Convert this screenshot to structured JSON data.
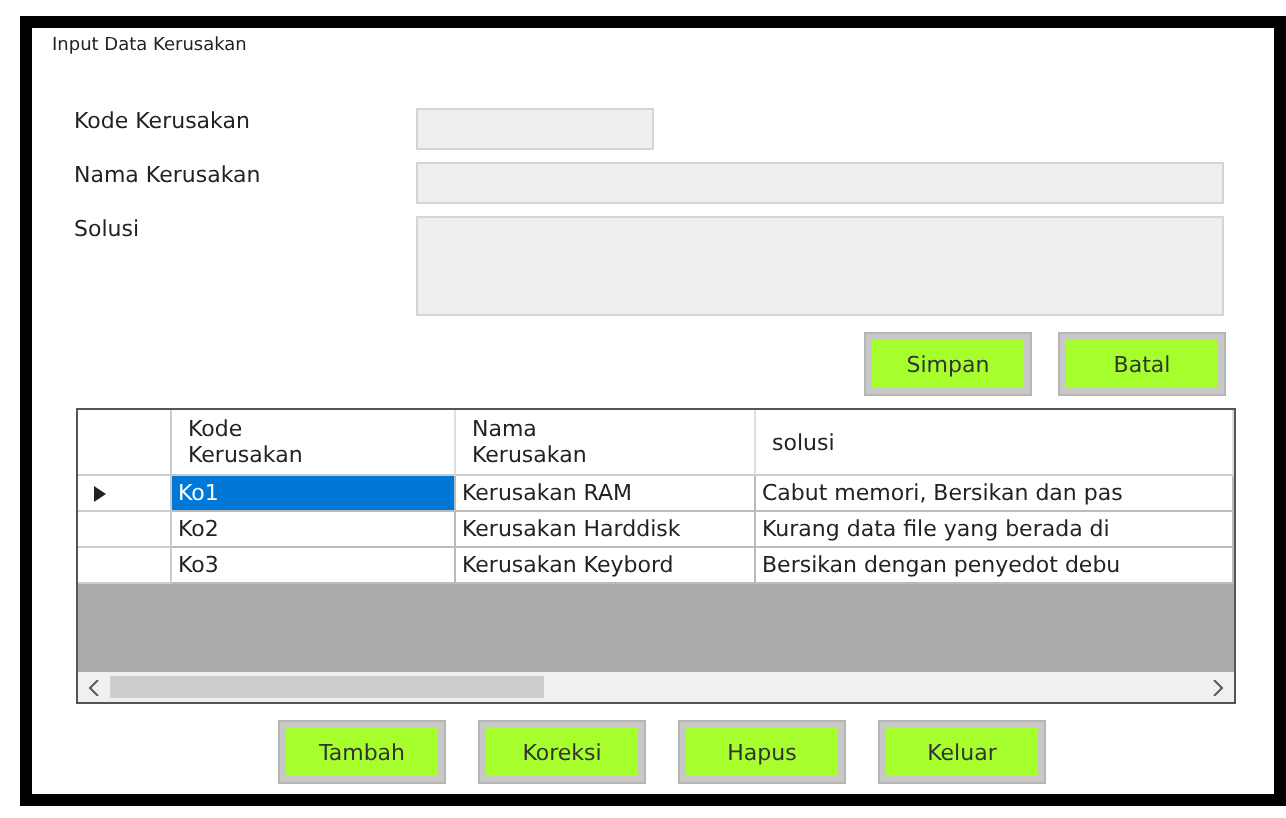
{
  "window": {
    "title": "Input Data Kerusakan"
  },
  "form": {
    "fields": [
      {
        "label": "Kode Kerusakan",
        "kind": "short"
      },
      {
        "label": "Nama Kerusakan",
        "kind": "long"
      },
      {
        "label": "Solusi",
        "kind": "multiline"
      }
    ],
    "buttons": [
      "Simpan",
      "Batal"
    ]
  },
  "table": {
    "columns": [
      "Kode\nKerusakan",
      "Nama\nKerusakan",
      "solusi"
    ],
    "rows": [
      {
        "cells": [
          "Ko1",
          "Kerusakan RAM",
          "Cabut memori, Bersikan dan pas"
        ],
        "selected": true
      },
      {
        "cells": [
          "Ko2",
          "Kerusakan Harddisk",
          "Kurang data file yang berada di"
        ],
        "selected": false
      },
      {
        "cells": [
          "Ko3",
          "Kerusakan Keybord",
          "Bersikan dengan penyedot debu"
        ],
        "selected": false
      }
    ]
  },
  "bottom_buttons": [
    "Tambah",
    "Koreksi",
    "Hapus",
    "Keluar"
  ]
}
